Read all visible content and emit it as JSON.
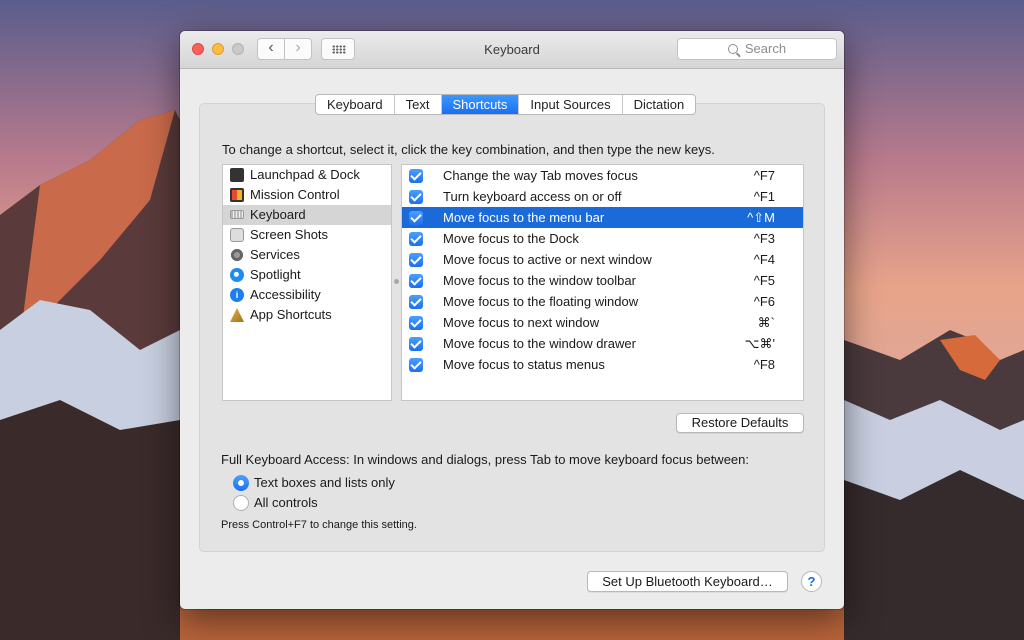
{
  "window": {
    "title": "Keyboard"
  },
  "search": {
    "placeholder": "Search"
  },
  "icons": {
    "back": "chevron-left-icon",
    "forward": "chevron-right-icon",
    "show_all": "grid-icon",
    "search": "magnifier-icon",
    "help": "question-icon"
  },
  "tabs": [
    {
      "label": "Keyboard",
      "selected": false
    },
    {
      "label": "Text",
      "selected": false
    },
    {
      "label": "Shortcuts",
      "selected": true
    },
    {
      "label": "Input Sources",
      "selected": false
    },
    {
      "label": "Dictation",
      "selected": false
    }
  ],
  "instructions": "To change a shortcut, select it, click the key combination, and then type the new keys.",
  "categories": [
    {
      "label": "Launchpad & Dock",
      "icon": "launchpad-icon"
    },
    {
      "label": "Mission Control",
      "icon": "mission-control-icon"
    },
    {
      "label": "Keyboard",
      "icon": "keyboard-icon",
      "selected": true
    },
    {
      "label": "Screen Shots",
      "icon": "screenshot-icon"
    },
    {
      "label": "Services",
      "icon": "gear-icon"
    },
    {
      "label": "Spotlight",
      "icon": "spotlight-icon"
    },
    {
      "label": "Accessibility",
      "icon": "accessibility-icon",
      "glyph": "i"
    },
    {
      "label": "App Shortcuts",
      "icon": "app-shortcuts-icon"
    }
  ],
  "shortcuts": [
    {
      "label": "Change the way Tab moves focus",
      "keys": "^F7",
      "checked": true
    },
    {
      "label": "Turn keyboard access on or off",
      "keys": "^F1",
      "checked": true
    },
    {
      "label": "Move focus to the menu bar",
      "keys": "^⇧M",
      "checked": true,
      "selected": true
    },
    {
      "label": "Move focus to the Dock",
      "keys": "^F3",
      "checked": true
    },
    {
      "label": "Move focus to active or next window",
      "keys": "^F4",
      "checked": true
    },
    {
      "label": "Move focus to the window toolbar",
      "keys": "^F5",
      "checked": true
    },
    {
      "label": "Move focus to the floating window",
      "keys": "^F6",
      "checked": true
    },
    {
      "label": "Move focus to next window",
      "keys": "⌘`",
      "checked": true
    },
    {
      "label": "Move focus to the window drawer",
      "keys": "⌥⌘'",
      "checked": true
    },
    {
      "label": "Move focus to status menus",
      "keys": "^F8",
      "checked": true
    }
  ],
  "restore_label": "Restore Defaults",
  "full_access": {
    "label": "Full Keyboard Access: In windows and dialogs, press Tab to move keyboard focus between:",
    "options": [
      {
        "label": "Text boxes and lists only",
        "selected": true
      },
      {
        "label": "All controls",
        "selected": false
      }
    ],
    "hint": "Press Control+F7 to change this setting."
  },
  "bluetooth_label": "Set Up Bluetooth Keyboard…",
  "help_label": "?",
  "colors": {
    "accent": "#1b6ad9",
    "tab_selected": "#2a82f7",
    "close": "#fc605c",
    "minimize": "#fdbc40",
    "zoom": "#c9c9c9",
    "window_bg": "#ececec"
  }
}
